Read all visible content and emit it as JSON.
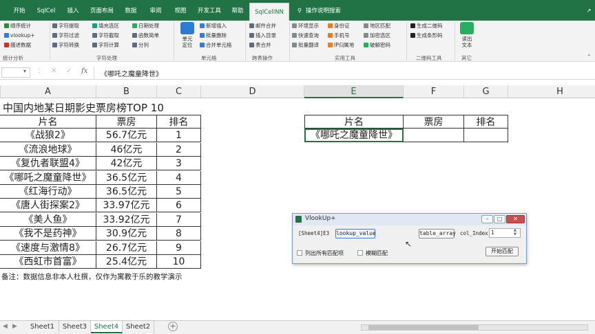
{
  "ribbon_tabs": {
    "items": [
      {
        "label": "开始"
      },
      {
        "label": "SqlCel"
      },
      {
        "label": "插入"
      },
      {
        "label": "页面布局"
      },
      {
        "label": "数据"
      },
      {
        "label": "审阅"
      },
      {
        "label": "视图"
      },
      {
        "label": "开发工具"
      },
      {
        "label": "帮助"
      },
      {
        "label": "SqlCellNN"
      }
    ],
    "search": "操作说明搜索"
  },
  "ribbon": {
    "g1": {
      "items": [
        "顺序统计",
        "vlookup+",
        "描述数据"
      ],
      "label": "统计分析"
    },
    "g2": {
      "items": [
        "字符提取",
        "字符过滤",
        "字符转换",
        "填充选区",
        "字符截取",
        "字符计算",
        "日期处理",
        "函数简单",
        "分列"
      ],
      "label": "字符处理"
    },
    "g3": {
      "big": "单元\n定位",
      "items": [
        "新增插入",
        "批量删除",
        "合并单元格"
      ],
      "label": "单元格"
    },
    "g4": {
      "items": [
        "邮件合并",
        "插入目录",
        "表合并"
      ],
      "label": "跨表操作"
    },
    "g5": {
      "items": [
        "环境显示",
        "快速查询",
        "批量翻译",
        "身份证",
        "手机号",
        "IP归属地",
        "地区匹配",
        "加密选区",
        "破解密码"
      ],
      "label": "实用工具"
    },
    "g6": {
      "items": [
        "生成二维码",
        "生成条形码"
      ],
      "label": "二维码工具"
    },
    "g7": {
      "big": "读出\n文本",
      "label": "其它"
    }
  },
  "formula_bar": {
    "name_box": "",
    "fx": "fx",
    "content": "《哪吒之魔童降世》"
  },
  "grid": {
    "columns": [
      "A",
      "B",
      "C",
      "D",
      "E",
      "F",
      "G",
      "H"
    ],
    "title": "中国内地某日期影史票房榜TOP 10",
    "headers": [
      "片名",
      "票房",
      "排名"
    ],
    "rows": [
      [
        "《战狼2》",
        "56.7亿元",
        "1"
      ],
      [
        "《流浪地球》",
        "46亿元",
        "2"
      ],
      [
        "《复仇者联盟4》",
        "42亿元",
        "3"
      ],
      [
        "《哪吒之魔童降世》",
        "36.5亿元",
        "4"
      ],
      [
        "《红海行动》",
        "36.5亿元",
        "5"
      ],
      [
        "《唐人街探案2》",
        "33.97亿元",
        "6"
      ],
      [
        "《美人鱼》",
        "33.92亿元",
        "7"
      ],
      [
        "《我不是药神》",
        "30.9亿元",
        "8"
      ],
      [
        "《速度与激情8》",
        "26.7亿元",
        "9"
      ],
      [
        "《西虹市首富》",
        "25.4亿元",
        "10"
      ]
    ],
    "note": "备注：数据信息非本人杜撰，仅作为寓教于乐的教学演示",
    "lookup_headers": [
      "片名",
      "票房",
      "排名"
    ],
    "lookup_row": [
      "《哪吒之魔童降世》",
      "",
      ""
    ]
  },
  "dialog": {
    "title": "VlookUp+",
    "cell_ref": "[Sheet4]E3",
    "lookup_value": "lookup_value",
    "table_array": "table_array",
    "col_index_label": "col_Index:",
    "col_index_value": "1",
    "option_all": "列出所有匹配项",
    "option_fuzzy": "模糊匹配",
    "start_button": "开始匹配"
  },
  "sheet_tabs": {
    "items": [
      {
        "label": "Sheet1"
      },
      {
        "label": "Sheet3"
      },
      {
        "label": "Sheet4"
      },
      {
        "label": "Sheet2"
      }
    ],
    "add": "+"
  },
  "colors": {
    "accent": "#217346"
  }
}
